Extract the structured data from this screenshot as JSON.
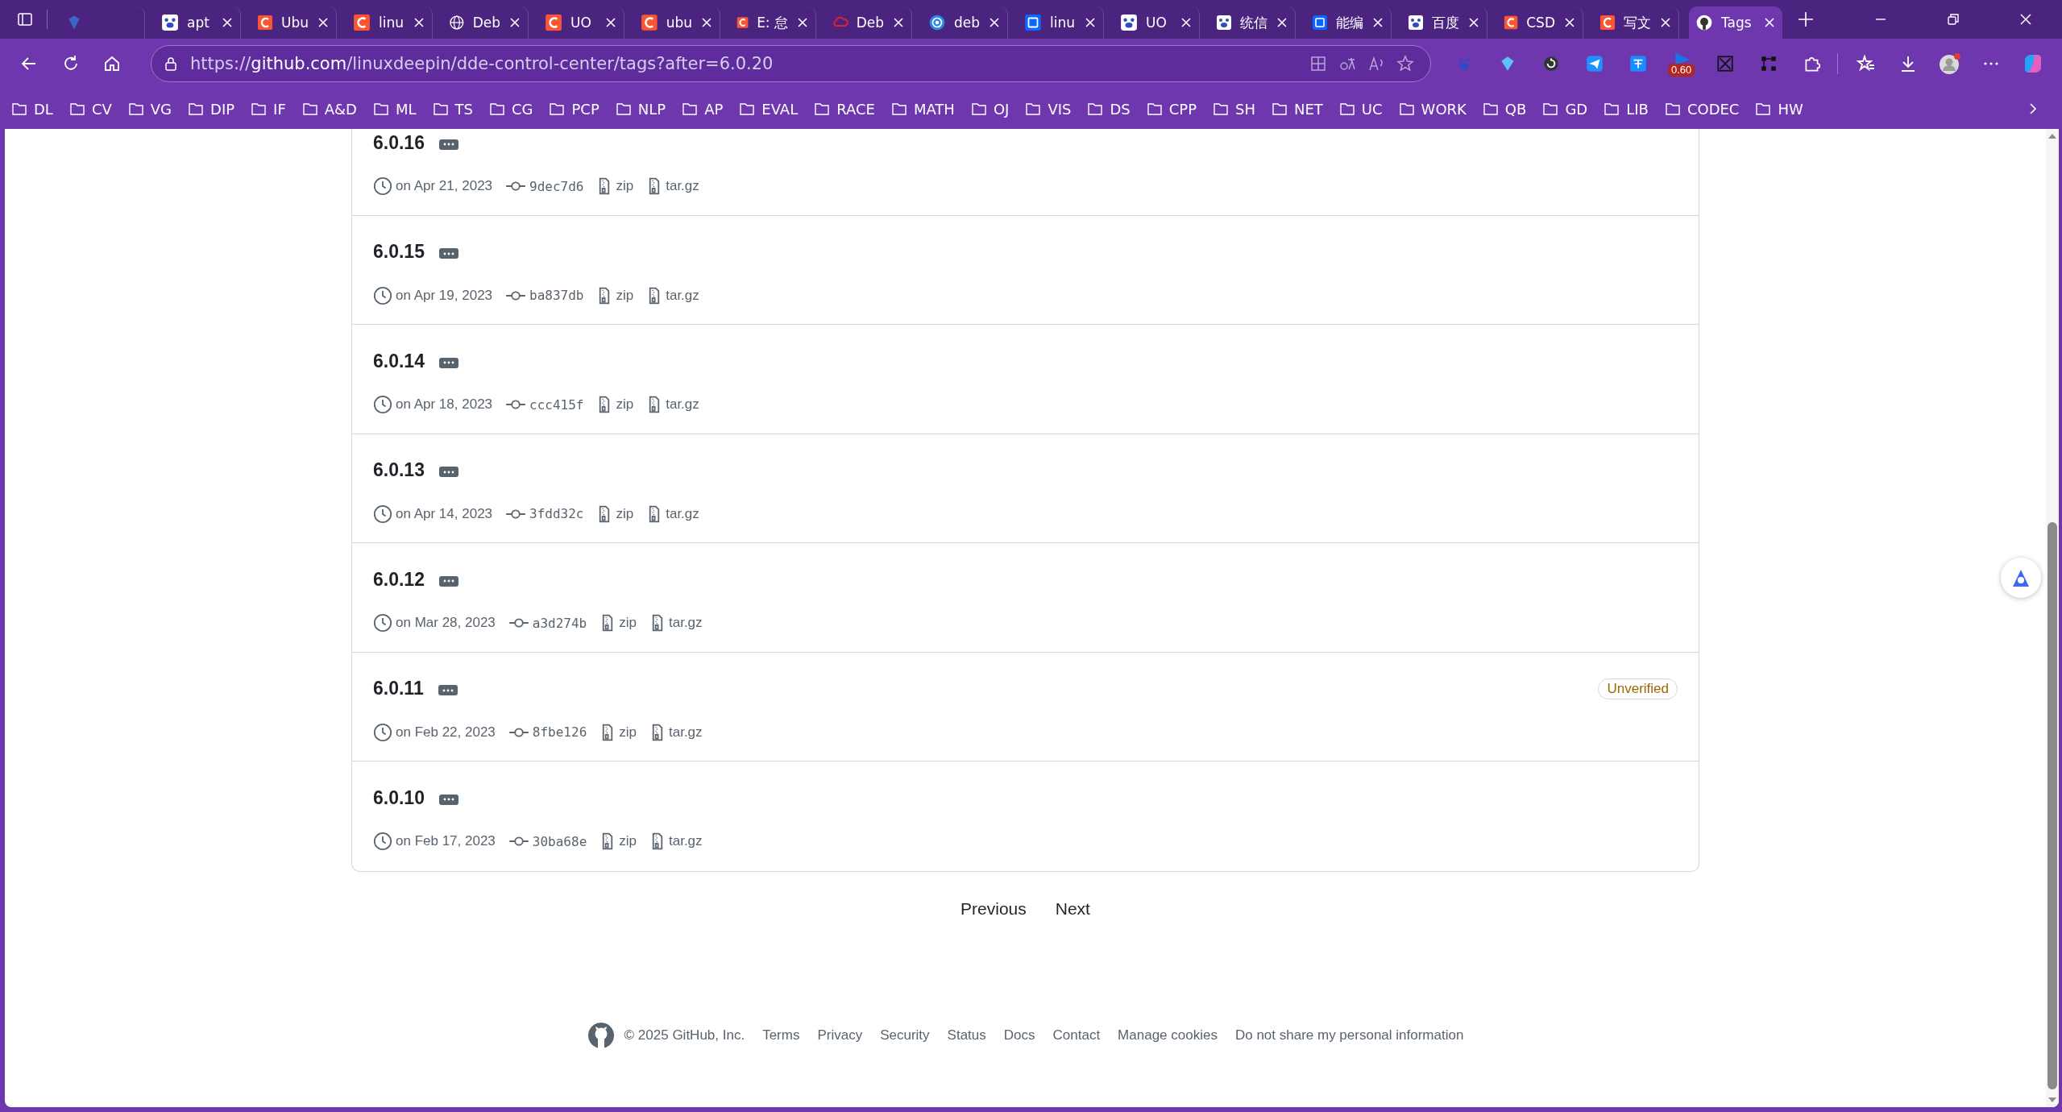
{
  "browser": {
    "tabs": [
      {
        "kind": "gem",
        "selected": false
      },
      {
        "kind": "paw",
        "title": "apt",
        "selected": false
      },
      {
        "kind": "letter-c",
        "title": "Ubu",
        "selected": false
      },
      {
        "kind": "letter-c",
        "title": "linu",
        "selected": false
      },
      {
        "kind": "globe",
        "title": "Deb",
        "selected": false
      },
      {
        "kind": "letter-c",
        "title": "UO",
        "selected": false
      },
      {
        "kind": "letter-c",
        "title": "ubu",
        "selected": false
      },
      {
        "kind": "letter-c",
        "title": "E: 怠",
        "selected": false
      },
      {
        "kind": "cloud",
        "title": "Deb",
        "selected": false
      },
      {
        "kind": "swirl",
        "title": "deb",
        "selected": false
      },
      {
        "kind": "square",
        "title": "linu",
        "selected": false
      },
      {
        "kind": "paw",
        "title": "UO",
        "selected": false
      },
      {
        "kind": "paw",
        "title": "统信",
        "selected": false
      },
      {
        "kind": "square",
        "title": "能编",
        "selected": false
      },
      {
        "kind": "paw",
        "title": "百度",
        "selected": false
      },
      {
        "kind": "letter-c",
        "title": "CSD",
        "selected": false
      },
      {
        "kind": "letter-c",
        "title": "写文",
        "selected": false
      },
      {
        "kind": "octocat",
        "title": "Tags",
        "selected": true
      }
    ],
    "address": "https://**github.com**/linuxdeepin/dde-control-center/tags?after=6.0.20",
    "extension_badge": "0.60",
    "bookmarks": [
      "DL",
      "CV",
      "VG",
      "DIP",
      "IF",
      "A&D",
      "ML",
      "TS",
      "CG",
      "PCP",
      "NLP",
      "AP",
      "EVAL",
      "RACE",
      "MATH",
      "OJ",
      "VIS",
      "DS",
      "CPP",
      "SH",
      "NET",
      "UC",
      "WORK",
      "QB",
      "GD",
      "LIB",
      "CODEC",
      "HW"
    ]
  },
  "tags": [
    {
      "name": "6.0.16",
      "date": "on Apr 21, 2023",
      "commit": "9dec7d6",
      "zip": "zip",
      "tarball": "tar.gz"
    },
    {
      "name": "6.0.15",
      "date": "on Apr 19, 2023",
      "commit": "ba837db",
      "zip": "zip",
      "tarball": "tar.gz"
    },
    {
      "name": "6.0.14",
      "date": "on Apr 18, 2023",
      "commit": "ccc415f",
      "zip": "zip",
      "tarball": "tar.gz"
    },
    {
      "name": "6.0.13",
      "date": "on Apr 14, 2023",
      "commit": "3fdd32c",
      "zip": "zip",
      "tarball": "tar.gz"
    },
    {
      "name": "6.0.12",
      "date": "on Mar 28, 2023",
      "commit": "a3d274b",
      "zip": "zip",
      "tarball": "tar.gz"
    },
    {
      "name": "6.0.11",
      "date": "on Feb 22, 2023",
      "commit": "8fbe126",
      "zip": "zip",
      "tarball": "tar.gz",
      "badge": "Unverified"
    },
    {
      "name": "6.0.10",
      "date": "on Feb 17, 2023",
      "commit": "30ba68e",
      "zip": "zip",
      "tarball": "tar.gz"
    }
  ],
  "pagination": [
    "Previous",
    "Next"
  ],
  "footer": {
    "copyright": "© 2025 GitHub, Inc.",
    "links": [
      "Terms",
      "Privacy",
      "Security",
      "Status",
      "Docs",
      "Contact",
      "Manage cookies",
      "Do not share my personal information"
    ]
  }
}
